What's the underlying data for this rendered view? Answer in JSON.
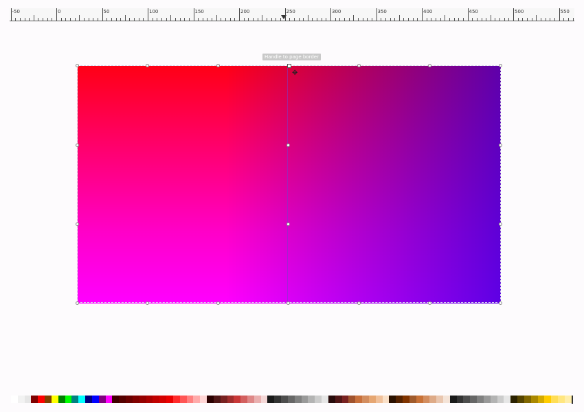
{
  "ruler": {
    "labels": [
      "-50",
      "0",
      "50",
      "100",
      "150",
      "200",
      "250",
      "300",
      "350",
      "400",
      "450",
      "500",
      "550"
    ]
  },
  "tooltip": {
    "text": "Handle to page border"
  },
  "palette": {
    "swatches": [
      "#ffffff",
      "#f2f2f2",
      "#e6e6e6",
      "#800000",
      "#ff0000",
      "#804000",
      "#ffff00",
      "#008000",
      "#00ff00",
      "#008080",
      "#00ffff",
      "#000080",
      "#0000ff",
      "#800080",
      "#ff00ff",
      "#400000",
      "#550000",
      "#6a0000",
      "#800000",
      "#950000",
      "#aa0000",
      "#c00000",
      "#d40000",
      "#ea0000",
      "#ff2a2a",
      "#ff5555",
      "#ff8080",
      "#ffaaaa",
      "#ffd5d5",
      "#2b0000",
      "#501616",
      "#782121",
      "#a02c2c",
      "#c83737",
      "#d35f5f",
      "#de8787",
      "#e9afaf",
      "#f4d7d7",
      "#1a1a1a",
      "#333333",
      "#4d4d4d",
      "#666666",
      "#808080",
      "#999999",
      "#b3b3b3",
      "#cccccc",
      "#e6e6e6",
      "#280b0b",
      "#501616",
      "#782121",
      "#a0522d",
      "#c8703c",
      "#d38d5f",
      "#e6a672",
      "#f0c09a",
      "#fae0c8",
      "#2b1100",
      "#552200",
      "#803300",
      "#a05a2c",
      "#c87137",
      "#d38d5f",
      "#deaa87",
      "#e9c6af",
      "#f4e3d7",
      "#1a1a1a",
      "#333333",
      "#4d4d4d",
      "#666666",
      "#808080",
      "#999999",
      "#b3b3b3",
      "#cccccc",
      "#e6e6e6",
      "#2b2200",
      "#554400",
      "#806600",
      "#aa8800",
      "#d4aa00",
      "#ffcc00",
      "#ffdd55",
      "#ffe680",
      "#ffeeaa"
    ]
  }
}
